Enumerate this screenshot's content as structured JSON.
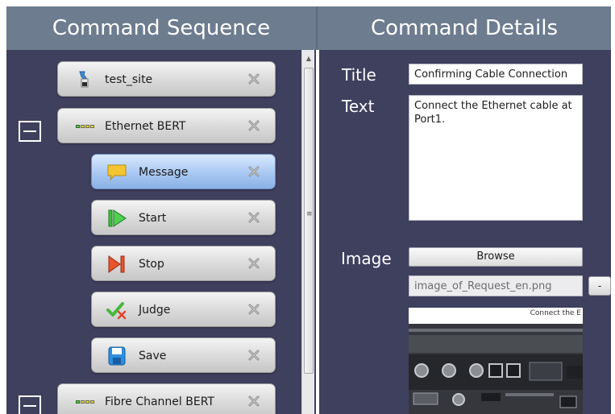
{
  "headers": {
    "left": "Command Sequence",
    "right": "Command Details"
  },
  "sequence": {
    "items": [
      {
        "label": "test_site",
        "icon": "flask-icon"
      },
      {
        "label": "Ethernet BERT",
        "icon": "led-indicator-icon",
        "group": true
      },
      {
        "label": "Message",
        "icon": "message-bubble-icon",
        "selected": true
      },
      {
        "label": "Start",
        "icon": "play-icon"
      },
      {
        "label": "Stop",
        "icon": "stop-icon"
      },
      {
        "label": "Judge",
        "icon": "checkmark-icon"
      },
      {
        "label": "Save",
        "icon": "floppy-disk-icon"
      },
      {
        "label": "Fibre Channel BERT",
        "icon": "led-indicator-icon",
        "group": true
      }
    ],
    "collapse_glyph": "−",
    "scroll_grip": "≡",
    "scroll_up": "▲"
  },
  "details": {
    "title_label": "Title",
    "title_value": "Confirming Cable Connection",
    "text_label": "Text",
    "text_value": "Connect the Ethernet cable at Port1.",
    "image_label": "Image",
    "browse_label": "Browse",
    "image_file": "image_of_Request_en.png",
    "remove_label": "-",
    "preview_caption": "Connect the E"
  },
  "colors": {
    "header_bg": "#6d7c8f",
    "panel_bg": "#3f3f5e",
    "selected_item": "#a9c8f2"
  }
}
